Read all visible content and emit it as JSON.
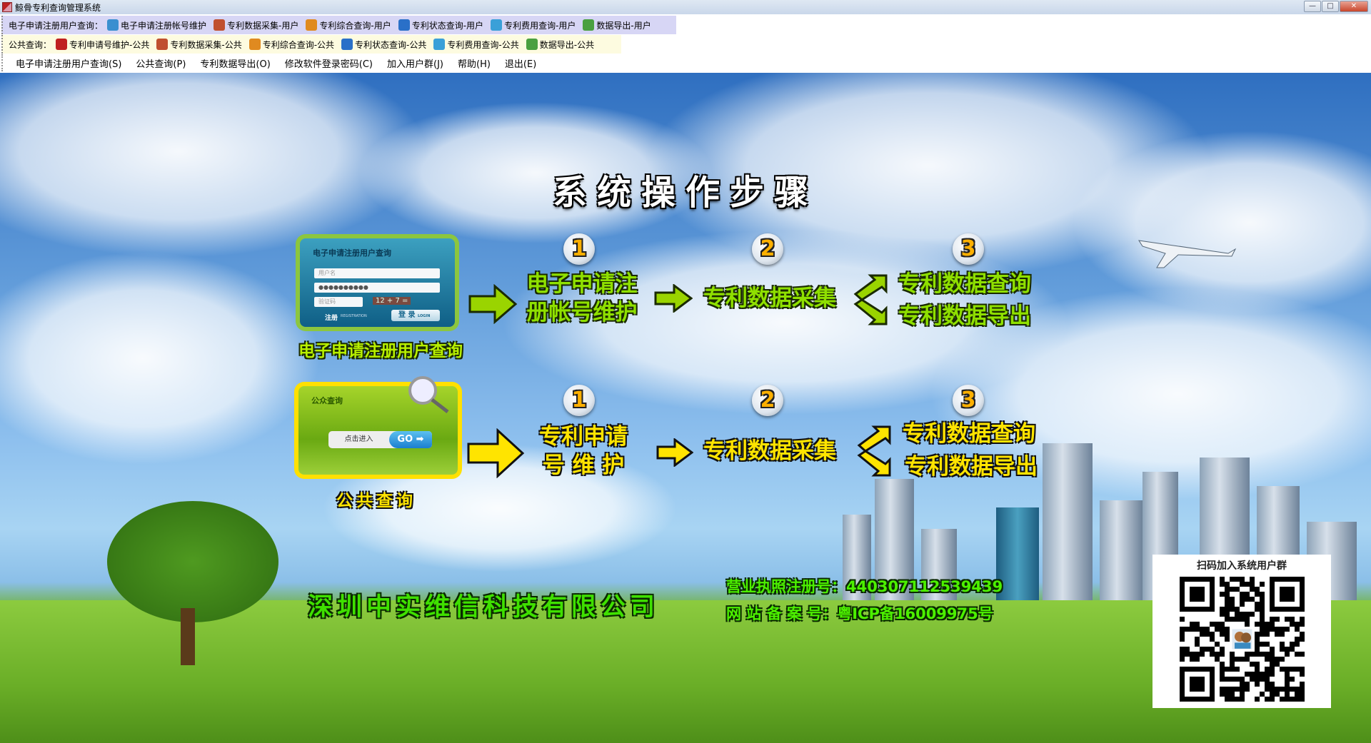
{
  "window": {
    "title": "鲸骨专利查询管理系统",
    "controls": [
      "—",
      "□",
      "✕"
    ]
  },
  "toolbar_user": {
    "label": "电子申请注册用户查询：",
    "buttons": [
      {
        "label": "电子申请注册帐号维护",
        "icon": "users-icon",
        "color": "#3a8fd0"
      },
      {
        "label": "专利数据采集-用户",
        "icon": "document-shield-icon",
        "color": "#c05030"
      },
      {
        "label": "专利综合查询-用户",
        "icon": "person-icon",
        "color": "#e08a20"
      },
      {
        "label": "专利状态查询-用户",
        "icon": "doc-search-icon",
        "color": "#2a70c8"
      },
      {
        "label": "专利费用查询-用户",
        "icon": "calendar-search-icon",
        "color": "#3aa0d8"
      },
      {
        "label": "数据导出-用户",
        "icon": "database-export-icon",
        "color": "#4aa040"
      }
    ]
  },
  "toolbar_public": {
    "label": "公共查询：",
    "buttons": [
      {
        "label": "专利申请号维护-公共",
        "icon": "pen-icon",
        "color": "#c02020"
      },
      {
        "label": "专利数据采集-公共",
        "icon": "document-shield-icon",
        "color": "#c05030"
      },
      {
        "label": "专利综合查询-公共",
        "icon": "person-icon",
        "color": "#e08a20"
      },
      {
        "label": "专利状态查询-公共",
        "icon": "doc-search-icon",
        "color": "#2a70c8"
      },
      {
        "label": "专利费用查询-公共",
        "icon": "calendar-search-icon",
        "color": "#3aa0d8"
      },
      {
        "label": "数据导出-公共",
        "icon": "database-export-icon",
        "color": "#4aa040"
      }
    ]
  },
  "menu": [
    "电子申请注册用户查询(S)",
    "公共查询(P)",
    "专利数据导出(O)",
    "修改软件登录密码(C)",
    "加入用户群(J)",
    "帮助(H)",
    "退出(E)"
  ],
  "main": {
    "title": "系统操作步骤",
    "login_card": {
      "title": "电子申请注册用户查询",
      "username_placeholder": "用户名",
      "password": "●●●●●●●●●●",
      "captcha_placeholder": "验证码",
      "captcha": "12 + 7 =",
      "register": "注册",
      "register_en": "REGISTRATION",
      "login": "登 录",
      "login_en": "LOGIN",
      "caption": "电子申请注册用户查询"
    },
    "public_card": {
      "title": "公众查询",
      "enter": "点击进入",
      "go": "GO ➡",
      "caption": "公共查询"
    },
    "row1": {
      "steps": [
        "1",
        "2",
        "3"
      ],
      "step1": [
        "电子申请注",
        "册帐号维护"
      ],
      "step2": "专利数据采集",
      "step3a": "专利数据查询",
      "step3b": "专利数据导出"
    },
    "row2": {
      "steps": [
        "1",
        "2",
        "3"
      ],
      "step1": [
        "专利申请",
        "号 维 护"
      ],
      "step2": "专利数据采集",
      "step3a": "专利数据查询",
      "step3b": "专利数据导出"
    },
    "company": "深圳中实维信科技有限公司",
    "license": "营业执照注册号：440307112539439",
    "icp": "网 站 备 案 号：粤ICP备16009975号",
    "qr_title": "扫码加入系统用户群"
  }
}
